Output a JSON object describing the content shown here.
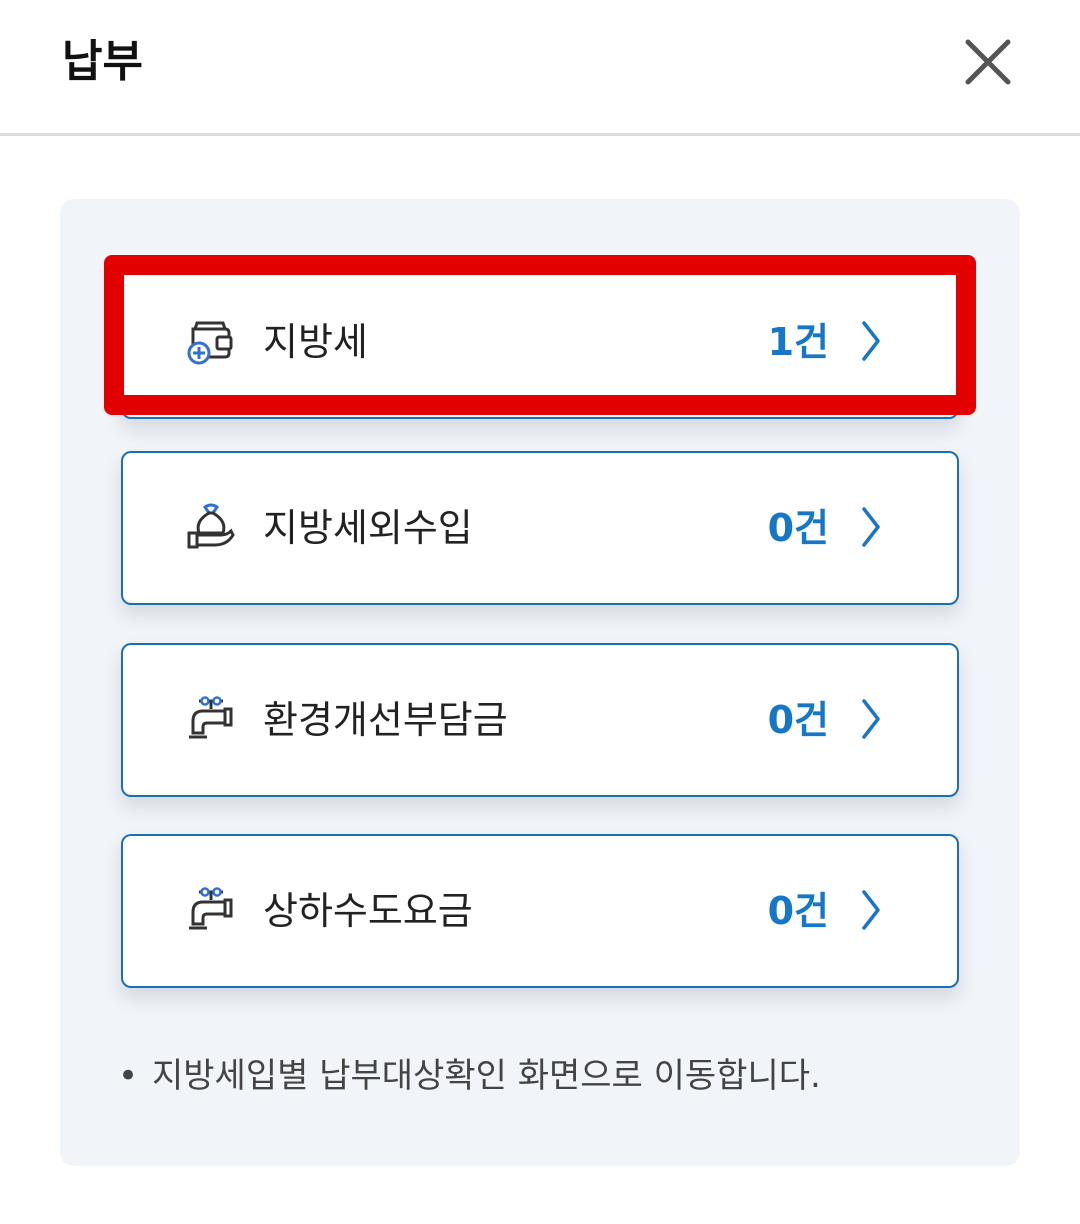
{
  "header": {
    "title": "납부",
    "close_icon": "close-icon"
  },
  "items": [
    {
      "label": "지방세",
      "count": "1건",
      "icon": "wallet-plus-icon",
      "highlighted": true
    },
    {
      "label": "지방세외수입",
      "count": "0건",
      "icon": "hand-money-bag-icon",
      "highlighted": false
    },
    {
      "label": "환경개선부담금",
      "count": "0건",
      "icon": "water-faucet-icon",
      "highlighted": false
    },
    {
      "label": "상하수도요금",
      "count": "0건",
      "icon": "water-faucet-icon",
      "highlighted": false
    }
  ],
  "note": {
    "bullet": "•",
    "text": "지방세입별 납부대상확인 화면으로 이동합니다."
  },
  "colors": {
    "accent": "#1676c7",
    "card_border": "#1a6fb7",
    "highlight": "#e20000",
    "panel_bg": "#f1f4f8"
  }
}
